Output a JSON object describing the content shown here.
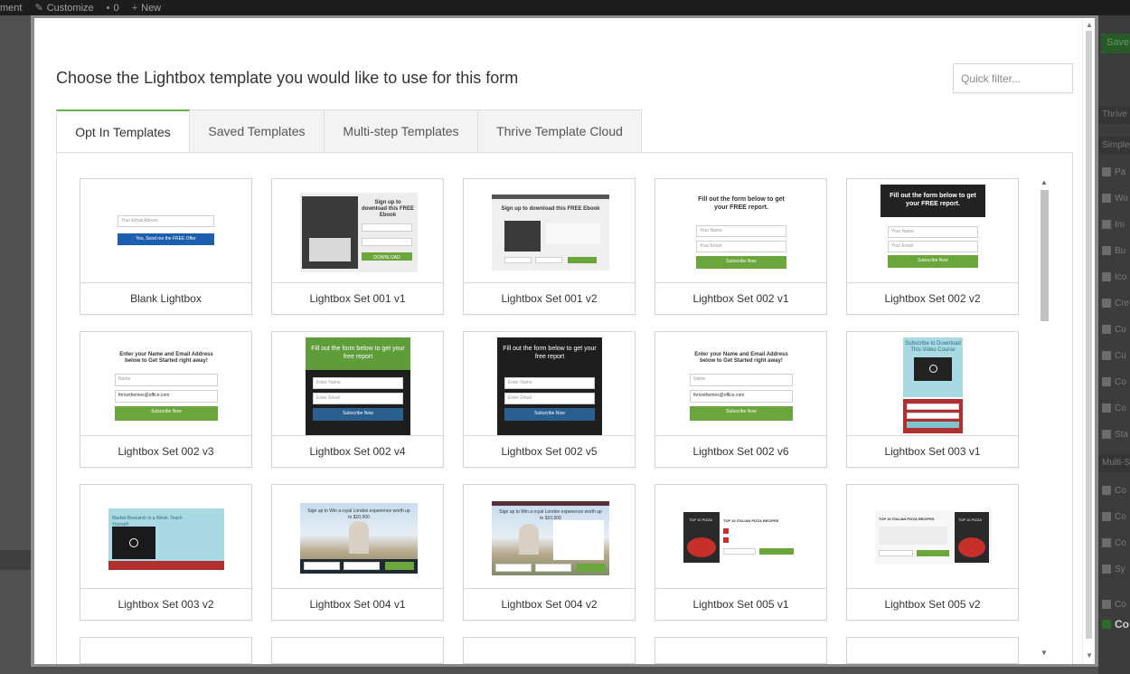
{
  "adminbar": {
    "item1": "ment",
    "item2": "Customize",
    "item3": "0",
    "item4": "New"
  },
  "right_panel": {
    "save": "Save",
    "items": [
      "Thrive",
      "Simple",
      "Pa",
      "Wo",
      "Im",
      "Bu",
      "Ico",
      "Cre",
      "Cu",
      "Cu",
      "Co",
      "Co",
      "Sta",
      "Multi-St",
      "Co",
      "Co",
      "Co",
      "Sy",
      "Co"
    ],
    "bottom": "Co"
  },
  "modal": {
    "title": "Choose the Lightbox template you would like to use for this form",
    "quick_filter_placeholder": "Quick filter...",
    "tabs": [
      "Opt In Templates",
      "Saved Templates",
      "Multi-step Templates",
      "Thrive Template Cloud"
    ],
    "active_tab": "Opt In Templates"
  },
  "templates": [
    {
      "name": "Blank Lightbox",
      "preview": {
        "email": "Your Email Adress",
        "button": "Yes, Send me the FREE Offer"
      }
    },
    {
      "name": "Lightbox Set 001 v1",
      "preview": {
        "heading": "Sign up to download this FREE Ebook",
        "button": "DOWNLOAD"
      }
    },
    {
      "name": "Lightbox Set 001 v2",
      "preview": {
        "heading": "Sign up to download this FREE Ebook"
      }
    },
    {
      "name": "Lightbox Set 002 v1",
      "preview": {
        "heading": "Fill out the form below to get your FREE report.",
        "name": "Your Name",
        "email": "Your Email",
        "button": "Subscribe Now"
      }
    },
    {
      "name": "Lightbox Set 002 v2",
      "preview": {
        "heading": "Fill out the form below to get your FREE report.",
        "name": "Your Name",
        "email": "Your Email",
        "button": "Subscribe Now"
      }
    },
    {
      "name": "Lightbox Set 002 v3",
      "preview": {
        "heading": "Enter your Name and Email Address below to Get Started right away!",
        "name": "Name",
        "email": "thrivethemes@office.com",
        "button": "Subscribe Now"
      }
    },
    {
      "name": "Lightbox Set 002 v4",
      "preview": {
        "heading": "Fill out the form below to get your free report",
        "name": "Enter Name",
        "email": "Enter Email",
        "button": "Subscribe Now"
      }
    },
    {
      "name": "Lightbox Set 002 v5",
      "preview": {
        "heading": "Fill out the form below to get your free report",
        "name": "Enter Name",
        "email": "Enter Email",
        "button": "Subscribe Now"
      }
    },
    {
      "name": "Lightbox Set 002 v6",
      "preview": {
        "heading": "Enter your Name and Email Address below to Get Started right away!",
        "name": "Name",
        "email": "thrivethemes@office.com",
        "button": "Subscribe Now"
      }
    },
    {
      "name": "Lightbox Set 003 v1",
      "preview": {
        "heading": "Subscribe to Download This Video Course"
      }
    },
    {
      "name": "Lightbox Set 003 v2",
      "preview": {
        "heading": "Market Research in a Week: Teach Yourself"
      }
    },
    {
      "name": "Lightbox Set 004 v1",
      "preview": {
        "heading": "Sign up to Win a royal London experience worth up to $10,000"
      }
    },
    {
      "name": "Lightbox Set 004 v2",
      "preview": {
        "heading": "Sign up to Win a royal London experience worth up to $10,000"
      }
    },
    {
      "name": "Lightbox Set 005 v1",
      "preview": {
        "heading": "TOP 10 ITALIAN PIZZA RECIPES",
        "book": "TOP 10 PIZZA"
      }
    },
    {
      "name": "Lightbox Set 005 v2",
      "preview": {
        "heading": "TOP 10 ITALIAN PIZZA RECIPES",
        "book": "TOP 10 PIZZA"
      }
    }
  ],
  "colors": {
    "accent_green": "#6aa63b",
    "blue_button": "#1c5faf",
    "dark_header": "#222222",
    "teal": "#7fc5cf",
    "red": "#b03030"
  }
}
